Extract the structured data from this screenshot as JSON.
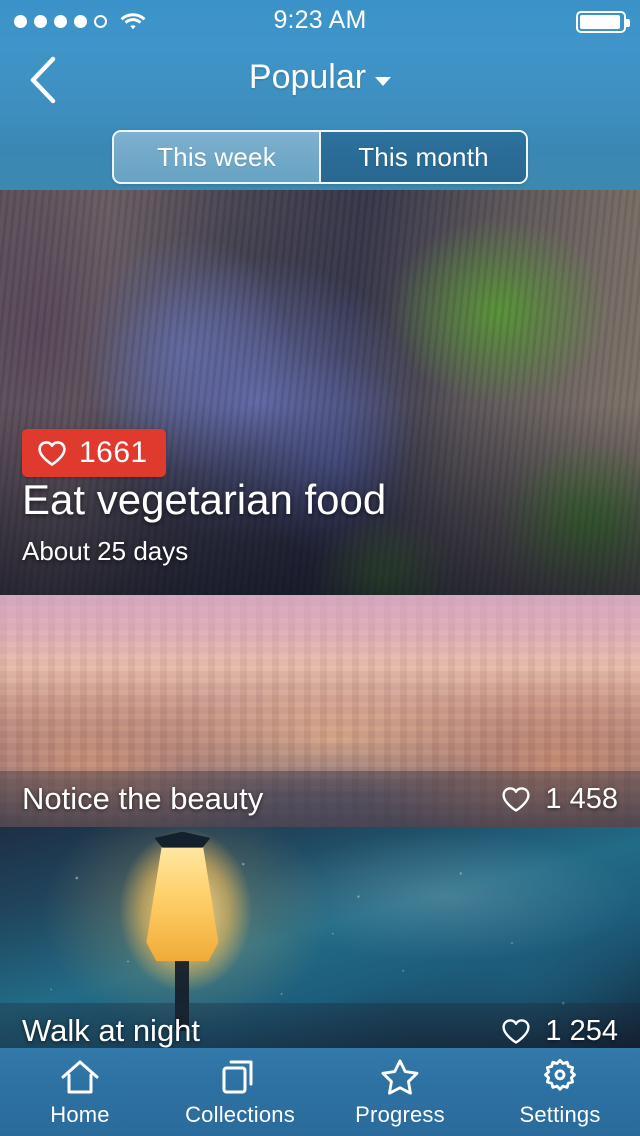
{
  "status_bar": {
    "signal_dots_total": 5,
    "signal_dots_filled": 4,
    "wifi_icon": "wifi-icon",
    "time": "9:23 AM",
    "battery_icon": "battery-full-icon"
  },
  "nav": {
    "back_icon": "chevron-left-icon",
    "title": "Popular",
    "caret_icon": "chevron-down-icon"
  },
  "segmented_control": {
    "options": [
      {
        "label": "This week",
        "selected": true
      },
      {
        "label": "This month",
        "selected": false
      }
    ]
  },
  "feed": {
    "hero": {
      "image_name": "grapes-on-plate-photo",
      "likes": "1661",
      "like_icon": "heart-outline-icon",
      "title": "Eat vegetarian food",
      "subtitle": "About 25 days"
    },
    "rows": [
      {
        "image_name": "venice-canal-sunset-photo",
        "title": "Notice the beauty",
        "like_icon": "heart-outline-icon",
        "likes": "1 458"
      },
      {
        "image_name": "street-lantern-rain-photo",
        "title": "Walk at night",
        "like_icon": "heart-outline-icon",
        "likes": "1 254"
      }
    ]
  },
  "tab_bar": {
    "tabs": [
      {
        "label": "Home",
        "icon": "home-icon"
      },
      {
        "label": "Collections",
        "icon": "collections-icon"
      },
      {
        "label": "Progress",
        "icon": "star-icon"
      },
      {
        "label": "Settings",
        "icon": "gear-icon"
      }
    ]
  },
  "colors": {
    "header_blue": "#3a92c8",
    "tabbar_blue": "#2d72a3",
    "badge_red": "#e0392e",
    "text_white": "#ffffff"
  }
}
